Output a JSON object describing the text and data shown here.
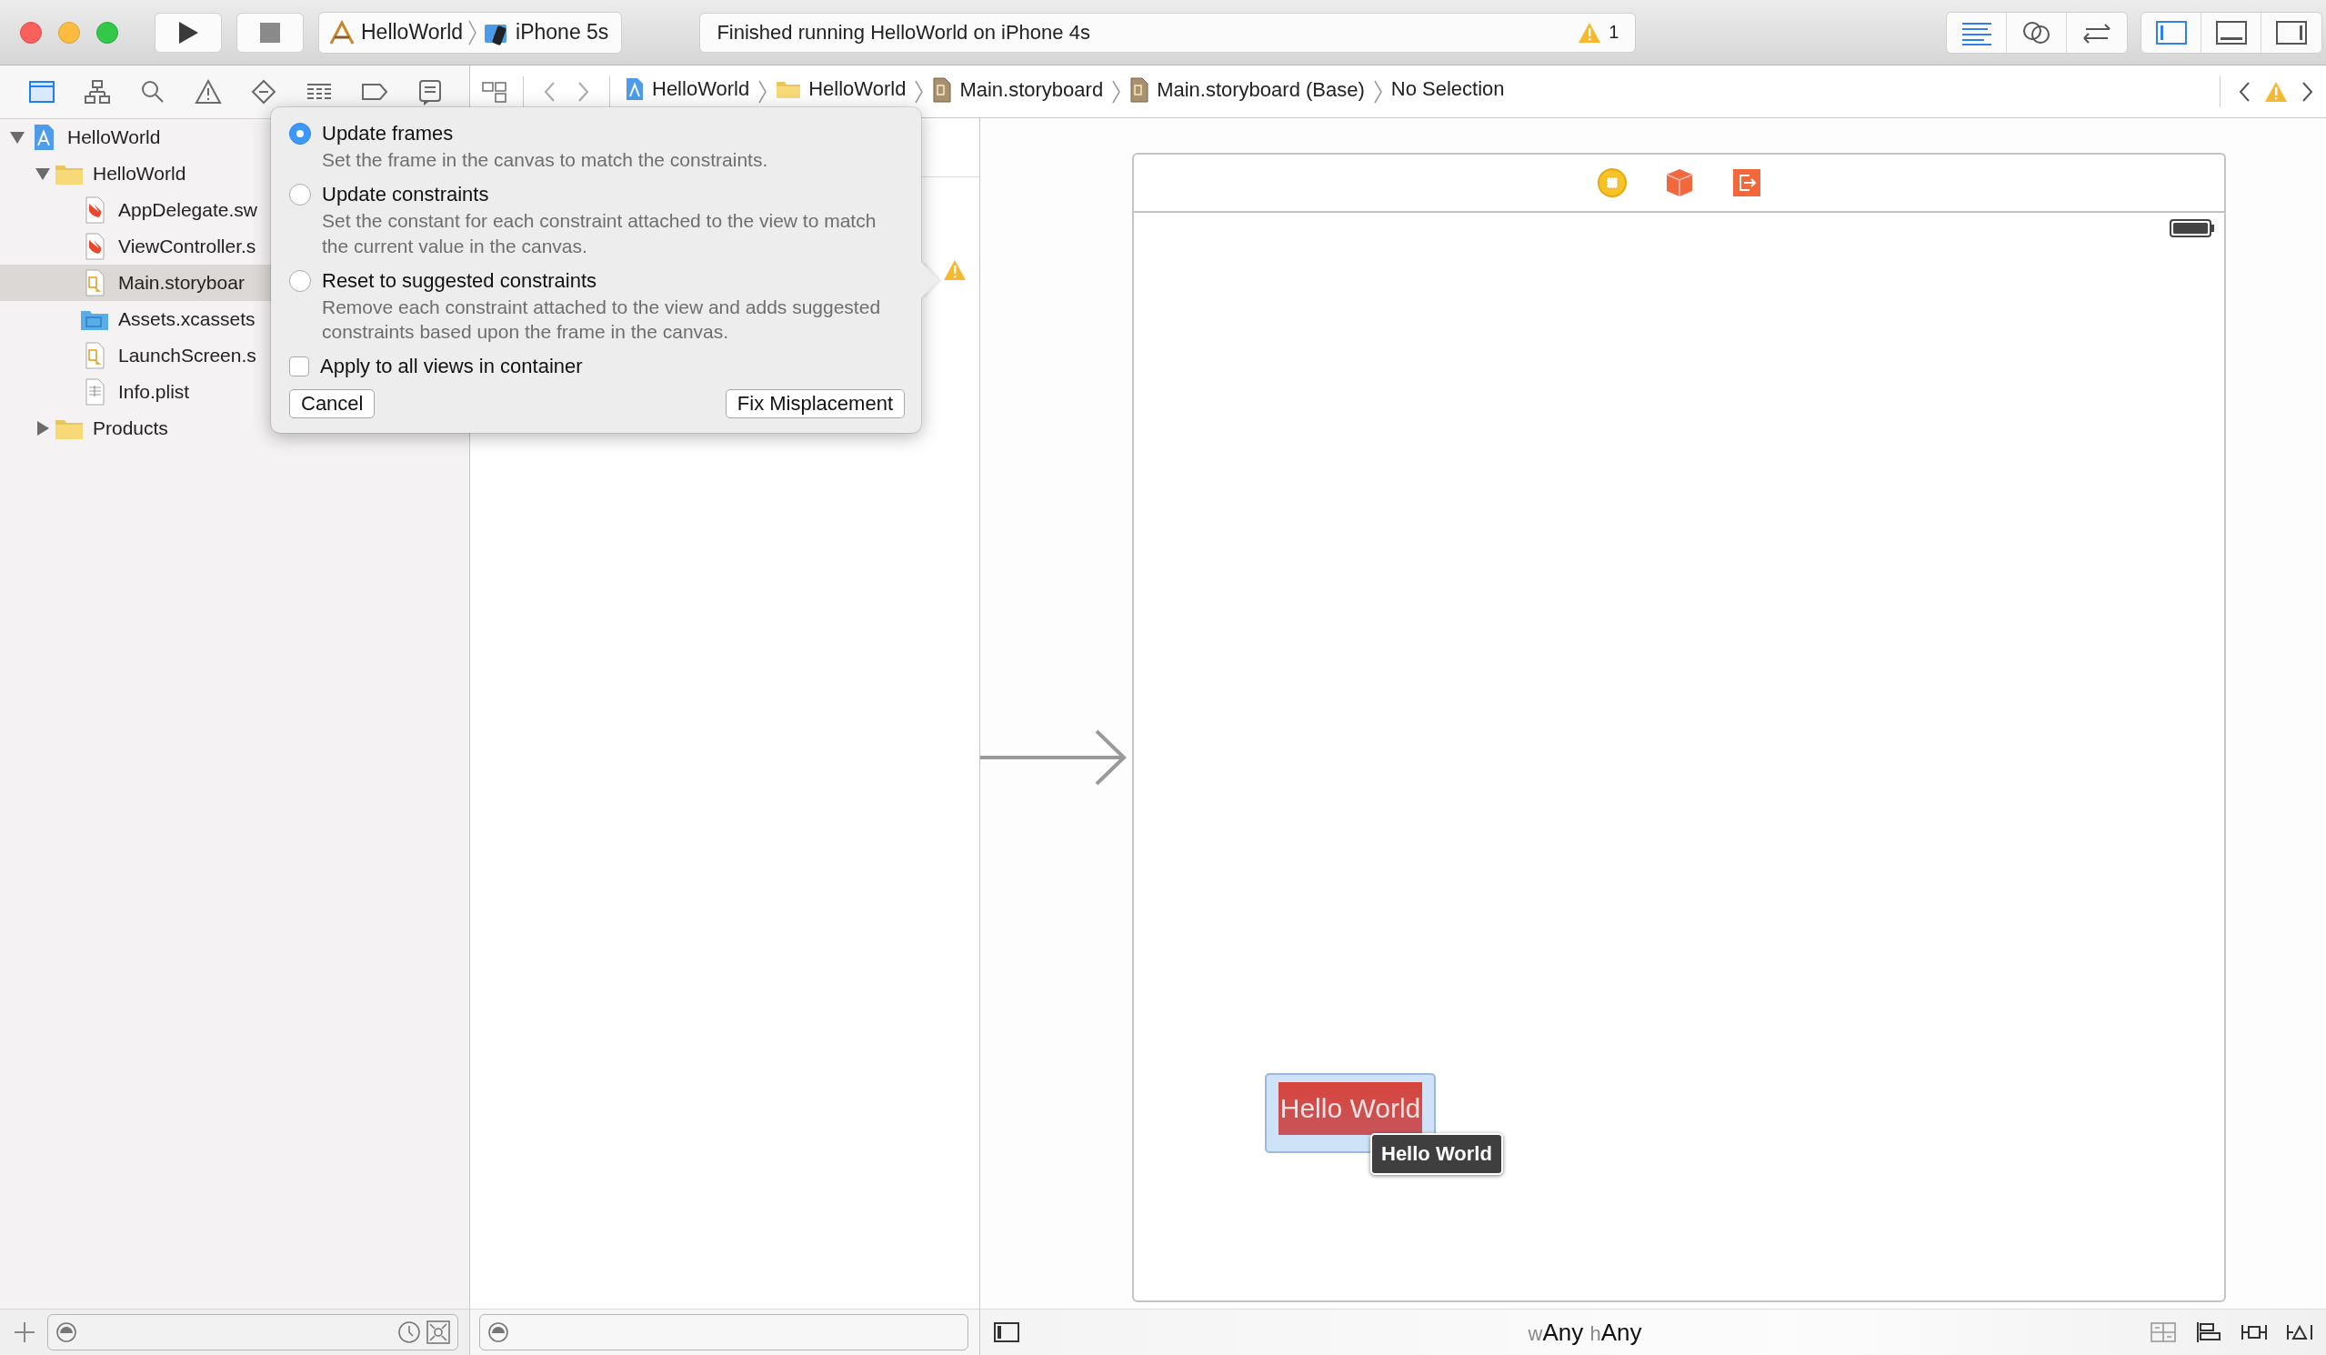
{
  "toolbar": {
    "scheme": {
      "project": "HelloWorld",
      "device": "iPhone 5s"
    },
    "activity": {
      "message": "Finished running HelloWorld on iPhone 4s",
      "warning_count": "1"
    },
    "editor_modes": [
      {
        "kind": "standard",
        "selected": true
      },
      {
        "kind": "assistant",
        "selected": false
      },
      {
        "kind": "version",
        "selected": false
      }
    ],
    "panels": [
      {
        "kind": "navigator",
        "selected": true
      },
      {
        "kind": "debug",
        "selected": false
      },
      {
        "kind": "utilities",
        "selected": false
      }
    ]
  },
  "navigator_tabs": [
    {
      "kind": "project",
      "selected": true
    },
    {
      "kind": "symbol",
      "selected": false
    },
    {
      "kind": "find",
      "selected": false
    },
    {
      "kind": "issue",
      "selected": false
    },
    {
      "kind": "test",
      "selected": false
    },
    {
      "kind": "debug",
      "selected": false
    },
    {
      "kind": "breakpoint",
      "selected": false
    },
    {
      "kind": "report",
      "selected": false
    }
  ],
  "file_tree": [
    {
      "name": "HelloWorld",
      "kind": "project",
      "expanded": true,
      "selected": false,
      "children": [
        {
          "name": "HelloWorld",
          "kind": "folder",
          "expanded": true,
          "selected": false,
          "children": [
            {
              "name": "AppDelegate.sw",
              "kind": "swift",
              "selected": false
            },
            {
              "name": "ViewController.s",
              "kind": "swift",
              "selected": false
            },
            {
              "name": "Main.storyboar",
              "kind": "storyboard",
              "selected": true
            },
            {
              "name": "Assets.xcassets",
              "kind": "assets",
              "selected": false
            },
            {
              "name": "LaunchScreen.s",
              "kind": "storyboard",
              "selected": false
            },
            {
              "name": "Info.plist",
              "kind": "plist",
              "selected": false
            }
          ]
        },
        {
          "name": "Products",
          "kind": "folder",
          "expanded": false,
          "selected": false
        }
      ]
    }
  ],
  "jump_bar": [
    {
      "label": "HelloWorld",
      "kind": "project"
    },
    {
      "label": "HelloWorld",
      "kind": "folder"
    },
    {
      "label": "Main.storyboard",
      "kind": "storyboard"
    },
    {
      "label": "Main.storyboard (Base)",
      "kind": "storyboard"
    },
    {
      "label": "No Selection",
      "kind": "none"
    }
  ],
  "popover": {
    "options": [
      {
        "label": "Update frames",
        "description": "Set the frame in the canvas to match the constraints.",
        "selected": true
      },
      {
        "label": "Update constraints",
        "description": "Set the constant for each constraint attached to the view to match the current value in the canvas.",
        "selected": false
      },
      {
        "label": "Reset to suggested constraints",
        "description": "Remove each constraint attached to the view and adds suggested constraints based upon the frame in the canvas.",
        "selected": false
      }
    ],
    "apply_all": {
      "label": "Apply to all views in container",
      "checked": false
    },
    "buttons": [
      "Cancel",
      "Fix Misplacement"
    ]
  },
  "canvas": {
    "label": "Hello World",
    "tooltip": "Hello World",
    "size_class": {
      "width_prefix": "w",
      "width": "Any",
      "height_prefix": "h",
      "height": "Any"
    }
  }
}
